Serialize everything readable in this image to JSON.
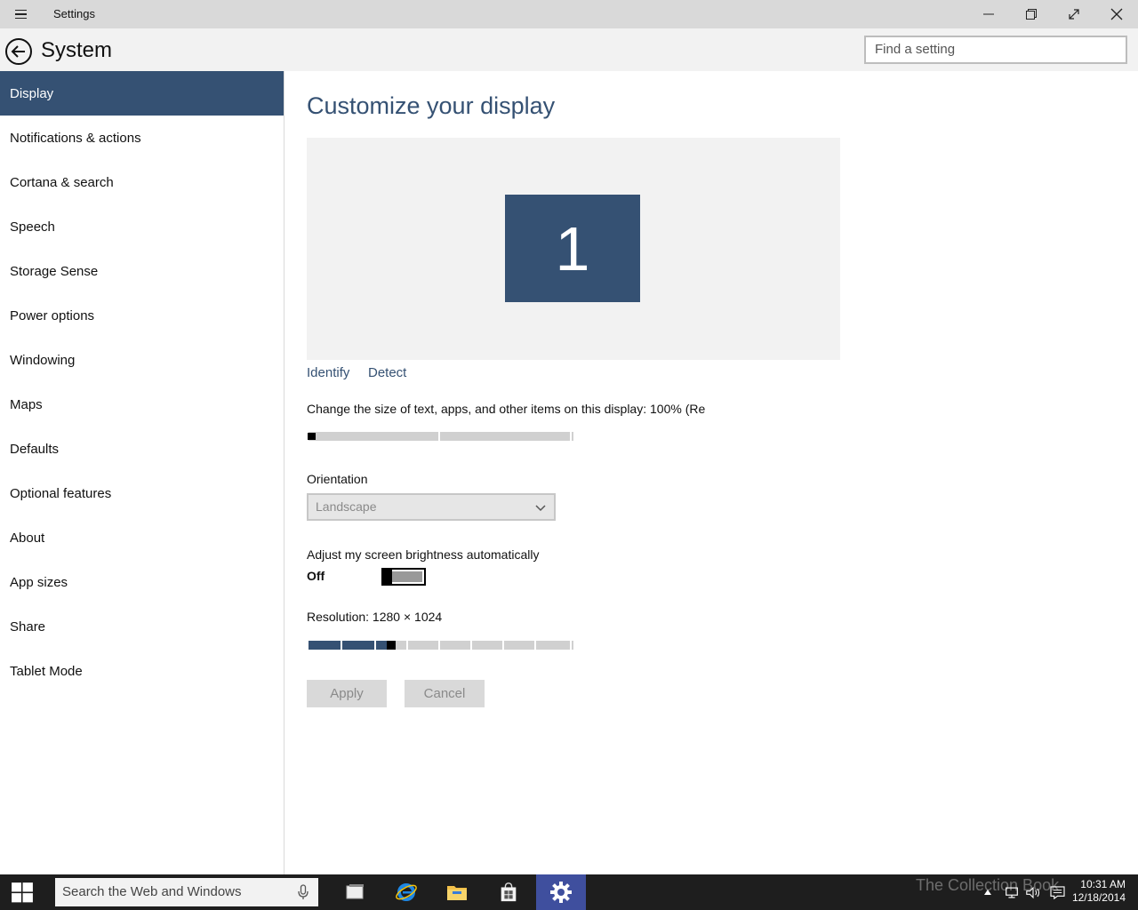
{
  "window": {
    "title": "Settings"
  },
  "header": {
    "title": "System",
    "search_placeholder": "Find a setting"
  },
  "sidebar": {
    "items": [
      {
        "label": "Display",
        "active": true
      },
      {
        "label": "Notifications & actions"
      },
      {
        "label": "Cortana & search"
      },
      {
        "label": "Speech"
      },
      {
        "label": "Storage Sense"
      },
      {
        "label": "Power options"
      },
      {
        "label": "Windowing"
      },
      {
        "label": "Maps"
      },
      {
        "label": "Defaults"
      },
      {
        "label": "Optional features"
      },
      {
        "label": "About"
      },
      {
        "label": "App sizes"
      },
      {
        "label": "Share"
      },
      {
        "label": "Tablet Mode"
      }
    ]
  },
  "main": {
    "heading": "Customize your display",
    "monitor_number": "1",
    "identify_link": "Identify",
    "detect_link": "Detect",
    "scale_label": "Change the size of text, apps, and other items on this display: 100% (Re",
    "scale_level": 0,
    "orientation_label": "Orientation",
    "orientation_value": "Landscape",
    "brightness_label": "Adjust my screen brightness automatically",
    "brightness_state": "Off",
    "resolution_label": "Resolution: 1280 × 1024",
    "resolution_level": 0.31,
    "apply_label": "Apply",
    "cancel_label": "Cancel"
  },
  "taskbar": {
    "search_placeholder": "Search the Web and Windows",
    "time": "10:31 AM",
    "date": "12/18/2014",
    "watermark": "The Collection Book"
  },
  "colors": {
    "accent": "#355173",
    "titlebar": "#d9d9d9",
    "taskbar": "#1e1e1e"
  }
}
